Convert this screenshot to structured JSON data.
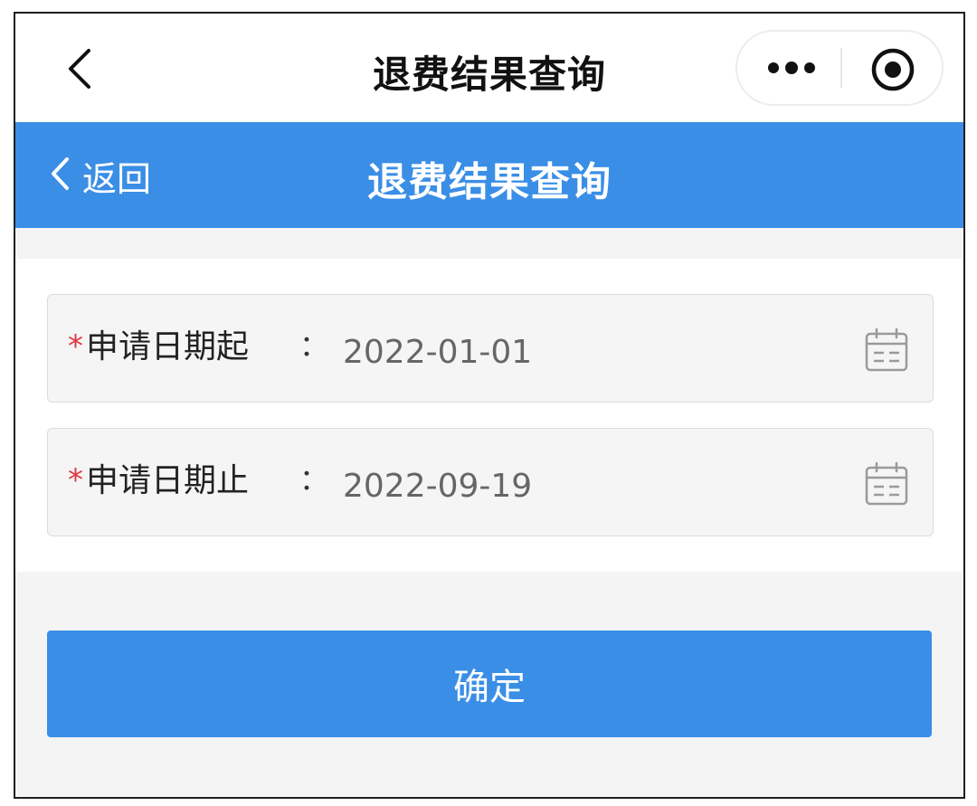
{
  "window": {
    "title": "退费结果查询",
    "back_icon": "chevron-left-icon",
    "more_icon": "more-dots-icon",
    "close_icon": "target-circle-icon"
  },
  "header": {
    "back_label": "返回",
    "title": "退费结果查询",
    "background": "#3a8ee6"
  },
  "form": {
    "fields": [
      {
        "required_mark": "*",
        "label": "申请日期起",
        "colon": "：",
        "value": "2022-01-01",
        "icon": "calendar-icon"
      },
      {
        "required_mark": "*",
        "label": "申请日期止",
        "colon": "：",
        "value": "2022-09-19",
        "icon": "calendar-icon"
      }
    ]
  },
  "actions": {
    "confirm_label": "确定"
  },
  "colors": {
    "accent": "#3a8ee6",
    "required": "#e0393e"
  }
}
